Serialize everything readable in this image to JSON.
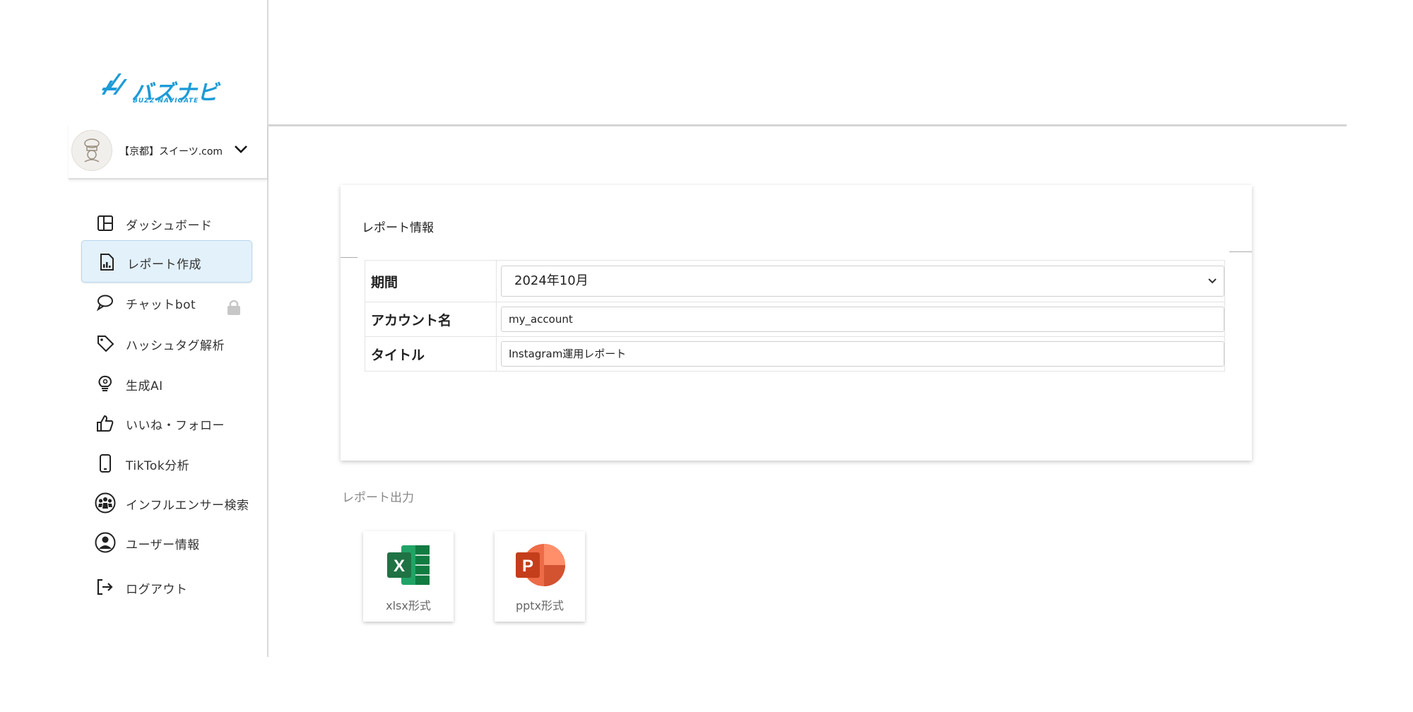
{
  "brand": {
    "logo_text": "バズナビ",
    "logo_sub": "BUZZ NAVIGATE",
    "accent": "#1c9bd8"
  },
  "account": {
    "name": "【京都】スイーツ.com"
  },
  "sidebar": {
    "items": [
      {
        "label": "ダッシュボード",
        "icon": "dashboard-icon"
      },
      {
        "label": "レポート作成",
        "icon": "report-icon",
        "active": true
      },
      {
        "label": "チャットbot",
        "icon": "chat-icon",
        "locked": true
      },
      {
        "label": "ハッシュタグ解析",
        "icon": "tag-icon"
      },
      {
        "label": "生成AI",
        "icon": "lightbulb-icon"
      },
      {
        "label": "いいね・フォロー",
        "icon": "thumbs-up-icon"
      },
      {
        "label": "TikTok分析",
        "icon": "phone-icon"
      },
      {
        "label": "インフルエンサー検索",
        "icon": "people-icon"
      },
      {
        "label": "ユーザー情報",
        "icon": "user-icon"
      },
      {
        "label": "ログアウト",
        "icon": "logout-icon"
      }
    ]
  },
  "report_info": {
    "title": "レポート情報",
    "rows": [
      {
        "label": "期間",
        "value": "2024年10月"
      },
      {
        "label": "アカウント名",
        "value": "my_account"
      },
      {
        "label": "タイトル",
        "value": "Instagram運用レポート"
      }
    ]
  },
  "output": {
    "label": "レポート出力",
    "xlsx_label": "xlsx形式",
    "pptx_label": "pptx形式",
    "xlsx_color": "#1f7244",
    "pptx_color": "#d04423"
  }
}
